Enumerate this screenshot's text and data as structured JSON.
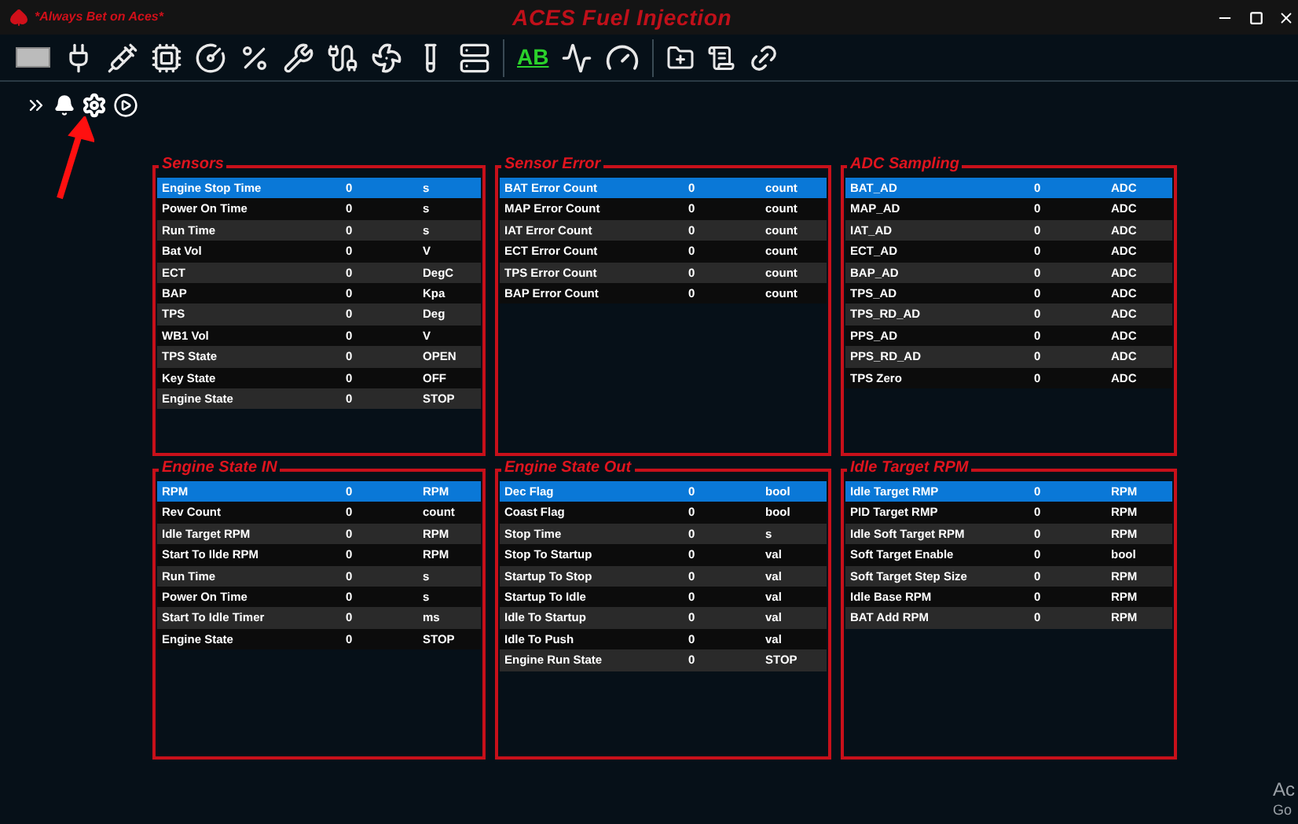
{
  "window": {
    "slogan": "*Always Bet on Aces*",
    "title": "ACES Fuel Injection"
  },
  "toolbar": {
    "text_button": "AB"
  },
  "panels": [
    {
      "title": "Sensors",
      "rows": [
        {
          "name": "Engine Stop Time",
          "value": "0",
          "unit": "s",
          "selected": true
        },
        {
          "name": "Power On Time",
          "value": "0",
          "unit": "s",
          "selected": false
        },
        {
          "name": "Run Time",
          "value": "0",
          "unit": "s",
          "selected": false
        },
        {
          "name": "Bat Vol",
          "value": "0",
          "unit": "V",
          "selected": false
        },
        {
          "name": "ECT",
          "value": "0",
          "unit": "DegC",
          "selected": false
        },
        {
          "name": "BAP",
          "value": "0",
          "unit": "Kpa",
          "selected": false
        },
        {
          "name": "TPS",
          "value": "0",
          "unit": "Deg",
          "selected": false
        },
        {
          "name": "WB1 Vol",
          "value": "0",
          "unit": "V",
          "selected": false
        },
        {
          "name": "TPS State",
          "value": "0",
          "unit": "OPEN",
          "selected": false
        },
        {
          "name": "Key State",
          "value": "0",
          "unit": "OFF",
          "selected": false
        },
        {
          "name": "Engine State",
          "value": "0",
          "unit": "STOP",
          "selected": false
        }
      ]
    },
    {
      "title": "Sensor Error",
      "rows": [
        {
          "name": "BAT Error Count",
          "value": "0",
          "unit": "count",
          "selected": true
        },
        {
          "name": "MAP Error Count",
          "value": "0",
          "unit": "count",
          "selected": false
        },
        {
          "name": "IAT Error Count",
          "value": "0",
          "unit": "count",
          "selected": false
        },
        {
          "name": "ECT Error Count",
          "value": "0",
          "unit": "count",
          "selected": false
        },
        {
          "name": "TPS Error Count",
          "value": "0",
          "unit": "count",
          "selected": false
        },
        {
          "name": "BAP Error Count",
          "value": "0",
          "unit": "count",
          "selected": false
        }
      ]
    },
    {
      "title": "ADC Sampling",
      "rows": [
        {
          "name": "BAT_AD",
          "value": "0",
          "unit": "ADC",
          "selected": true
        },
        {
          "name": "MAP_AD",
          "value": "0",
          "unit": "ADC",
          "selected": false
        },
        {
          "name": "IAT_AD",
          "value": "0",
          "unit": "ADC",
          "selected": false
        },
        {
          "name": "ECT_AD",
          "value": "0",
          "unit": "ADC",
          "selected": false
        },
        {
          "name": "BAP_AD",
          "value": "0",
          "unit": "ADC",
          "selected": false
        },
        {
          "name": "TPS_AD",
          "value": "0",
          "unit": "ADC",
          "selected": false
        },
        {
          "name": "TPS_RD_AD",
          "value": "0",
          "unit": "ADC",
          "selected": false
        },
        {
          "name": "PPS_AD",
          "value": "0",
          "unit": "ADC",
          "selected": false
        },
        {
          "name": "PPS_RD_AD",
          "value": "0",
          "unit": "ADC",
          "selected": false
        },
        {
          "name": "TPS Zero",
          "value": "0",
          "unit": "ADC",
          "selected": false
        }
      ]
    },
    {
      "title": "Engine State IN",
      "rows": [
        {
          "name": "RPM",
          "value": "0",
          "unit": "RPM",
          "selected": true
        },
        {
          "name": "Rev Count",
          "value": "0",
          "unit": "count",
          "selected": false
        },
        {
          "name": "Idle Target RPM",
          "value": "0",
          "unit": "RPM",
          "selected": false
        },
        {
          "name": "Start To Ilde RPM",
          "value": "0",
          "unit": "RPM",
          "selected": false
        },
        {
          "name": "Run Time",
          "value": "0",
          "unit": "s",
          "selected": false
        },
        {
          "name": "Power On Time",
          "value": "0",
          "unit": "s",
          "selected": false
        },
        {
          "name": "Start To Idle Timer",
          "value": "0",
          "unit": "ms",
          "selected": false
        },
        {
          "name": "Engine State",
          "value": "0",
          "unit": "STOP",
          "selected": false
        }
      ]
    },
    {
      "title": "Engine State Out",
      "rows": [
        {
          "name": "Dec Flag",
          "value": "0",
          "unit": "bool",
          "selected": true
        },
        {
          "name": "Coast Flag",
          "value": "0",
          "unit": "bool",
          "selected": false
        },
        {
          "name": "Stop Time",
          "value": "0",
          "unit": "s",
          "selected": false
        },
        {
          "name": "Stop To Startup",
          "value": "0",
          "unit": "val",
          "selected": false
        },
        {
          "name": "Startup To Stop",
          "value": "0",
          "unit": "val",
          "selected": false
        },
        {
          "name": "Startup To Idle",
          "value": "0",
          "unit": "val",
          "selected": false
        },
        {
          "name": "Idle To Startup",
          "value": "0",
          "unit": "val",
          "selected": false
        },
        {
          "name": "Idle To Push",
          "value": "0",
          "unit": "val",
          "selected": false
        },
        {
          "name": "Engine Run State",
          "value": "0",
          "unit": "STOP",
          "selected": false
        }
      ]
    },
    {
      "title": "Idle Target RPM",
      "rows": [
        {
          "name": "Idle Target RMP",
          "value": "0",
          "unit": "RPM",
          "selected": true
        },
        {
          "name": "PID Target RMP",
          "value": "0",
          "unit": "RPM",
          "selected": false
        },
        {
          "name": "Idle Soft Target RPM",
          "value": "0",
          "unit": "RPM",
          "selected": false
        },
        {
          "name": "Soft Target Enable",
          "value": "0",
          "unit": "bool",
          "selected": false
        },
        {
          "name": "Soft Target Step Size",
          "value": "0",
          "unit": "RPM",
          "selected": false
        },
        {
          "name": "Idle Base RPM",
          "value": "0",
          "unit": "RPM",
          "selected": false
        },
        {
          "name": "BAT Add RPM",
          "value": "0",
          "unit": "RPM",
          "selected": false
        }
      ]
    }
  ],
  "activation_notice": [
    "Ac",
    "Go"
  ]
}
